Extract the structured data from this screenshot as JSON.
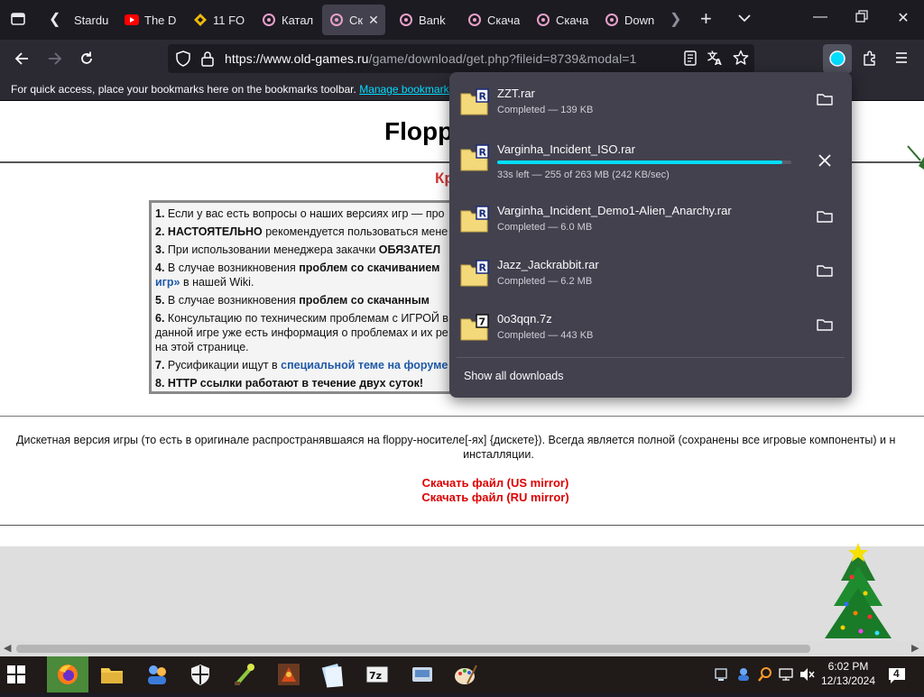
{
  "tabs": [
    {
      "label": "Stardu",
      "icon": "stardust-favicon"
    },
    {
      "label": "The D",
      "icon": "youtube-favicon"
    },
    {
      "label": "11 FO",
      "icon": "binance-favicon"
    },
    {
      "label": "Катал",
      "icon": "old-games-favicon"
    },
    {
      "label": "Ск",
      "icon": "old-games-favicon",
      "active": true
    },
    {
      "label": "Bank",
      "icon": "old-games-favicon"
    },
    {
      "label": "Скача",
      "icon": "old-games-favicon"
    },
    {
      "label": "Скача",
      "icon": "old-games-favicon"
    },
    {
      "label": "Down",
      "icon": "old-games-favicon"
    }
  ],
  "navbar": {
    "url_host": "https://www.old-games.ru",
    "url_path": "/game/download/get.php?fileid=8739&modal=1"
  },
  "bookmarks_bar": {
    "text": "For quick access, place your bookmarks here on the bookmarks toolbar.",
    "link": "Manage bookmarks"
  },
  "page": {
    "title": "Flopp",
    "subtitle": "Кр",
    "notes": [
      {
        "num": "1.",
        "text": "Если у вас есть вопросы о наших версиях игр — про"
      },
      {
        "num": "2.",
        "bold": "НАСТОЯТЕЛЬНО",
        "text": " рекомендуется пользоваться мене"
      },
      {
        "num": "3.",
        "text": "При использовании менеджера закачки ",
        "bold_after": "ОБЯЗАТЕЛ"
      },
      {
        "num": "4.",
        "text": "В случае возникновения ",
        "bold_after": "проблем со скачиванием"
      },
      {
        "num": "",
        "link": "игр»",
        "text": " в нашей Wiki."
      },
      {
        "num": "5.",
        "text": "В случае возникновения ",
        "bold_after": "проблем со скачанным"
      },
      {
        "num": "6.",
        "text": "Консультацию по техническим проблемам с ИГРОЙ в"
      },
      {
        "num": "",
        "text": "данной игре уже есть информация о проблемах и их ре"
      },
      {
        "num": "",
        "text": "на этой странице."
      },
      {
        "num": "7.",
        "text": "Русификации ищут в ",
        "link_after": "специальной теме на форуме"
      },
      {
        "num": "8.",
        "bold": "HTTP ссылки работают в течение двух суток!"
      }
    ],
    "description_line1": "Дискетная версия игры (то есть в оригинале распространявшаяся на floppy-носителе[-ях] {дискете}). Всегда является полной (сохранены все игровые компоненты) и н",
    "description_line2": "инсталляции.",
    "link_us": "Скачать файл (US mirror)",
    "link_ru": "Скачать файл (RU mirror)"
  },
  "downloads": {
    "items": [
      {
        "name": "ZZT.rar",
        "status": "Completed — 139 KB",
        "icon": "winrar-file-icon",
        "badge": "R",
        "action": "folder-icon"
      },
      {
        "name": "Varginha_Incident_ISO.rar",
        "status": "33s left — 255 of 263 MB (242 KB/sec)",
        "icon": "winrar-file-icon",
        "badge": "R",
        "action": "cancel-icon",
        "progress": 0.969
      },
      {
        "name": "Varginha_Incident_Demo1-Alien_Anarchy.rar",
        "status": "Completed — 6.0 MB",
        "icon": "winrar-file-icon",
        "badge": "R",
        "action": "folder-icon"
      },
      {
        "name": "Jazz_Jackrabbit.rar",
        "status": "Completed — 6.2 MB",
        "icon": "winrar-file-icon",
        "badge": "R",
        "action": "folder-icon"
      },
      {
        "name": "0o3qqn.7z",
        "status": "Completed — 443 KB",
        "icon": "7zip-file-icon",
        "badge": "7",
        "action": "folder-icon"
      }
    ],
    "show_all": "Show all downloads"
  },
  "taskbar": {
    "time": "6:02 PM",
    "date": "12/13/2024",
    "notification_count": "4"
  },
  "colors": {
    "accent": "#00ddff",
    "link_red": "#dd0000",
    "link_blue": "#1f5aa8",
    "subtitle_red": "#d33a3a"
  }
}
